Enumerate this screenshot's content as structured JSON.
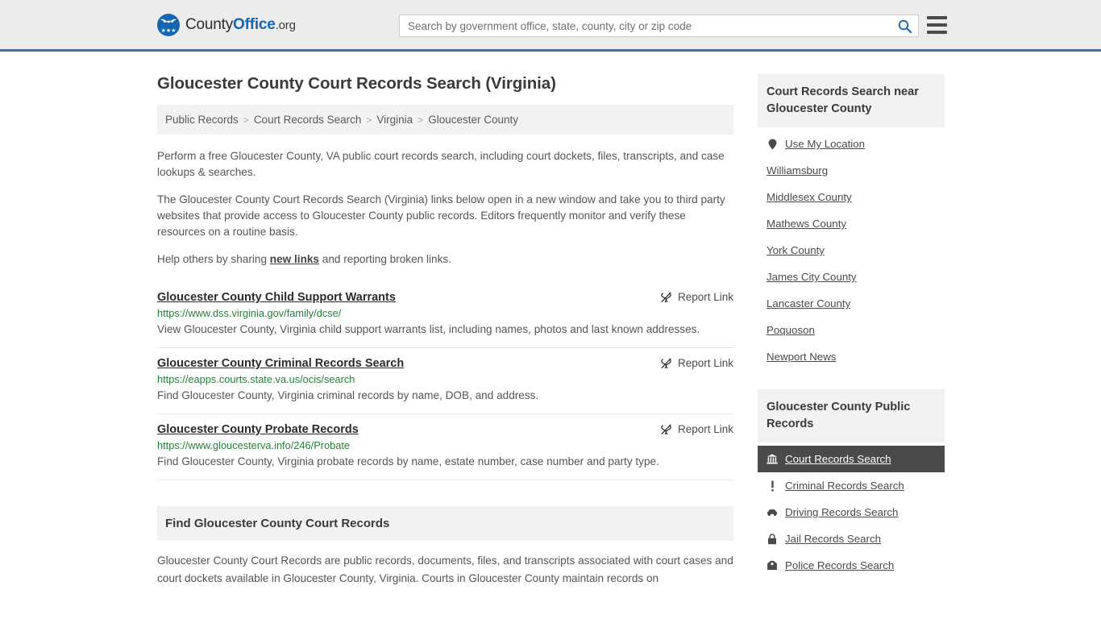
{
  "header": {
    "brand": {
      "part1": "County",
      "part2": "Office",
      "part3": ".org",
      "logo_icon": "eagle-shield-icon"
    },
    "search": {
      "placeholder": "Search by government office, state, county, city or zip code",
      "value": "",
      "icon": "search-icon"
    },
    "menu_icon": "hamburger-menu-icon",
    "accent_color": "#3c74a8"
  },
  "main": {
    "page_title": "Gloucester County Court Records Search (Virginia)",
    "breadcrumb": [
      {
        "label": "Public Records"
      },
      {
        "label": "Court Records Search"
      },
      {
        "label": "Virginia"
      },
      {
        "label": "Gloucester County"
      }
    ],
    "breadcrumb_separator": ">",
    "intro_1": "Perform a free Gloucester County, VA public court records search, including court dockets, files, transcripts, and case lookups & searches.",
    "intro_2": "The Gloucester County Court Records Search (Virginia) links below open in a new window and take you to third party websites that provide access to Gloucester County public records. Editors frequently monitor and verify these resources on a routine basis.",
    "intro_3_before": "Help others by sharing ",
    "intro_3_link": "new links",
    "intro_3_after": " and reporting broken links.",
    "report_link_label": "Report Link",
    "report_link_icon": "broken-link-icon",
    "results": [
      {
        "title": "Gloucester County Child Support Warrants",
        "url": "https://www.dss.virginia.gov/family/dcse/",
        "description": "View Gloucester County, Virginia child support warrants list, including names, photos and last known addresses."
      },
      {
        "title": "Gloucester County Criminal Records Search",
        "url": "https://eapps.courts.state.va.us/ocis/search",
        "description": "Find Gloucester County, Virginia criminal records by name, DOB, and address."
      },
      {
        "title": "Gloucester County Probate Records",
        "url": "https://www.gloucesterva.info/246/Probate",
        "description": "Find Gloucester County, Virginia probate records by name, estate number, case number and party type."
      }
    ],
    "find_section": {
      "heading": "Find Gloucester County Court Records",
      "body": "Gloucester County Court Records are public records, documents, files, and transcripts associated with court cases and court dockets available in Gloucester County, Virginia. Courts in Gloucester County maintain records on"
    }
  },
  "sidebar": {
    "nearby": {
      "heading": "Court Records Search near Gloucester County",
      "items": [
        {
          "label": "Use My Location",
          "icon": "map-pin-icon"
        },
        {
          "label": "Williamsburg",
          "icon": ""
        },
        {
          "label": "Middlesex County",
          "icon": ""
        },
        {
          "label": "Mathews County",
          "icon": ""
        },
        {
          "label": "York County",
          "icon": ""
        },
        {
          "label": "James City County",
          "icon": ""
        },
        {
          "label": "Lancaster County",
          "icon": ""
        },
        {
          "label": "Poquoson",
          "icon": ""
        },
        {
          "label": "Newport News",
          "icon": ""
        }
      ]
    },
    "public_records": {
      "heading": "Gloucester County Public Records",
      "items": [
        {
          "label": "Court Records Search",
          "icon": "courthouse-icon",
          "active": true
        },
        {
          "label": "Criminal Records Search",
          "icon": "exclamation-icon",
          "active": false
        },
        {
          "label": "Driving Records Search",
          "icon": "car-icon",
          "active": false
        },
        {
          "label": "Jail Records Search",
          "icon": "lock-icon",
          "active": false
        },
        {
          "label": "Police Records Search",
          "icon": "police-badge-icon",
          "active": false
        }
      ]
    }
  }
}
